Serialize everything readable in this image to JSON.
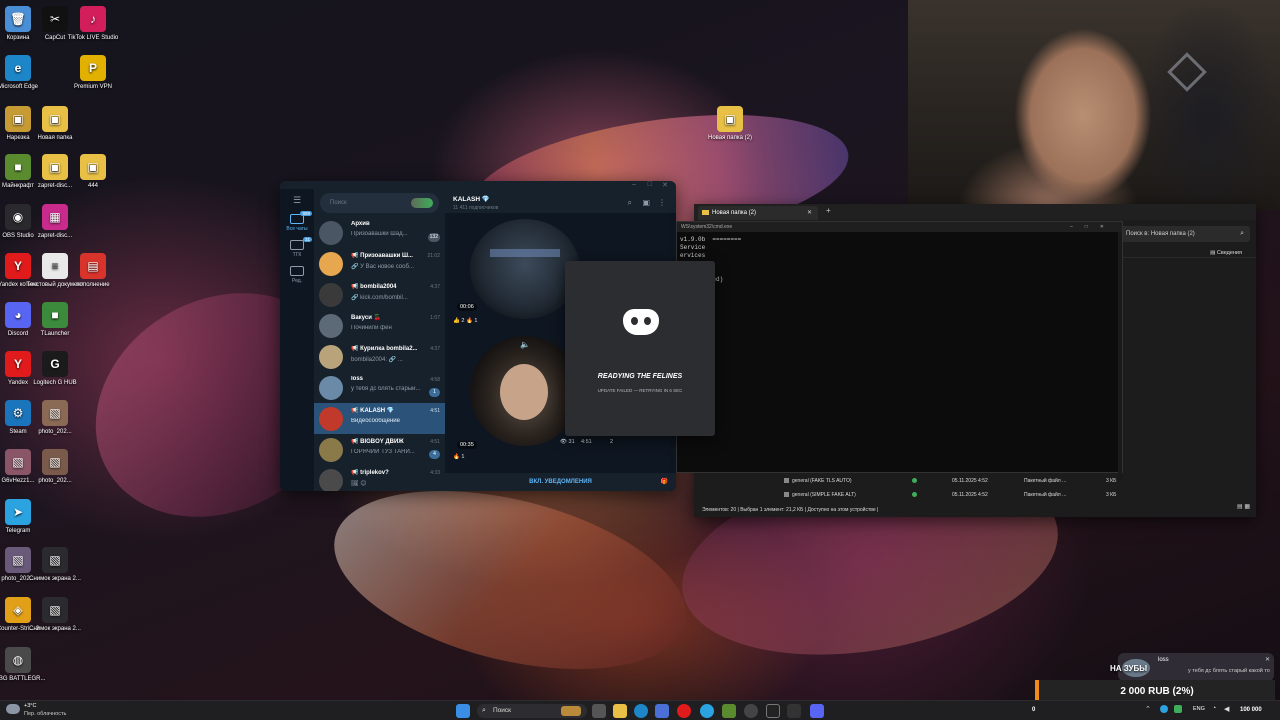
{
  "desktop": {
    "icons": [
      {
        "label": "Корзина",
        "color": "#4a8fd6",
        "glyph": "🗑"
      },
      {
        "label": "CapCut",
        "color": "#111111",
        "glyph": "✂"
      },
      {
        "label": "TikTok LIVE Studio",
        "color": "#d21e5b",
        "glyph": "♪"
      },
      {
        "label": "Microsoft Edge",
        "color": "#1d86c9",
        "glyph": "e"
      },
      {
        "label": "Premium VPN",
        "color": "#e2b100",
        "glyph": "P"
      },
      {
        "label": "Нарезка",
        "color": "#c69b33",
        "glyph": "▣"
      },
      {
        "label": "Новая папка",
        "color": "#e8c045",
        "glyph": "▣"
      },
      {
        "label": "Майнкрафт",
        "color": "#5a8c2f",
        "glyph": "■"
      },
      {
        "label": "zapret-disc...",
        "color": "#e8c045",
        "glyph": "▣"
      },
      {
        "label": "444",
        "color": "#e8c045",
        "glyph": "▣"
      },
      {
        "label": "OBS Studio",
        "color": "#2a2a2e",
        "glyph": "◉"
      },
      {
        "label": "zapret-disc...",
        "color": "#c82b8b",
        "glyph": "▦"
      },
      {
        "label": "Yandex котика",
        "color": "#e11b1b",
        "glyph": "Y"
      },
      {
        "label": "Текстовый документ",
        "color": "#e9e9e9",
        "glyph": "≡"
      },
      {
        "label": "пополнение",
        "color": "#d8342c",
        "glyph": "▤"
      },
      {
        "label": "Discord",
        "color": "#5865f2",
        "glyph": "◕"
      },
      {
        "label": "TLauncher",
        "color": "#3c8a3c",
        "glyph": "■"
      },
      {
        "label": "Yandex",
        "color": "#e11b1b",
        "glyph": "Y"
      },
      {
        "label": "Logitech G HUB",
        "color": "#1b1b1b",
        "glyph": "G"
      },
      {
        "label": "Steam",
        "color": "#1b75bc",
        "glyph": "⚙"
      },
      {
        "label": "photo_202...",
        "color": "#8a6a55",
        "glyph": "▧"
      },
      {
        "label": "G6vHezz1...",
        "color": "#8a5566",
        "glyph": "▧"
      },
      {
        "label": "photo_202...",
        "color": "#7a5a4a",
        "glyph": "▧"
      },
      {
        "label": "Telegram",
        "color": "#2aa3e0",
        "glyph": "➤"
      },
      {
        "label": "photo_202...",
        "color": "#6a5a7a",
        "glyph": "▧"
      },
      {
        "label": "Снимок экрана 2...",
        "color": "#2b2b2f",
        "glyph": "▧"
      },
      {
        "label": "Counter-Stri... 2",
        "color": "#e2a018",
        "glyph": "◈"
      },
      {
        "label": "Снимок экрана 2...",
        "color": "#2b2b2f",
        "glyph": "▧"
      },
      {
        "label": "PUBG BATTLEGR...",
        "color": "#4a4a4a",
        "glyph": "◍"
      },
      {
        "label": "Новая папка (2)",
        "color": "#e8c045",
        "glyph": "▣"
      }
    ]
  },
  "telegram": {
    "search_placeholder": "Поиск",
    "folders": [
      {
        "label": "Все чаты",
        "badge": "999"
      },
      {
        "label": "ТГК",
        "badge": "31"
      },
      {
        "label": "Ред.",
        "badge": ""
      }
    ],
    "chats": [
      {
        "name": "Архив",
        "msg": "Призоавашки Шад...",
        "time": "",
        "badge": "132",
        "color": "#4a5664"
      },
      {
        "name": "📢 Призоавашки Ш...",
        "msg": "🔗 У Вас новое сооб...",
        "time": "21:02",
        "badge": "",
        "color": "#e6a74f"
      },
      {
        "name": "📢 bombila2004",
        "msg": "🔗 kick.com/bombil...",
        "time": "4:37",
        "badge": "",
        "color": "#3a3a3a"
      },
      {
        "name": "Вакуси 🍒",
        "msg": "Починили фен",
        "time": "1:07",
        "badge": "",
        "color": "#5c6a78"
      },
      {
        "name": "📢 Курилка bombila2...",
        "msg": "bombila2004: 🔗 ...",
        "time": "4:37",
        "badge": "",
        "color": "#b9a37a"
      },
      {
        "name": "loss",
        "msg": "у тебя дс блять старый...",
        "time": "4:58",
        "badge": "1",
        "color": "#6a8aa8"
      },
      {
        "name": "📢 KALASH 💎",
        "msg": "Видеосообщение",
        "time": "4:51",
        "badge": "",
        "color": "#c0392b",
        "active": true
      },
      {
        "name": "📢 BIGBOY ДВИЖ",
        "msg": "ГОРЯЧИЙ ТУЗ ТАНИ...",
        "time": "4:51",
        "badge": "4",
        "color": "#8a7a4a"
      },
      {
        "name": "📢 triplekov?",
        "msg": "🖼 😊",
        "time": "4:33",
        "badge": "",
        "color": "#4a4a4a"
      }
    ],
    "chat": {
      "title": "KALASH 💎",
      "subtitle": "11 411 подписчиков",
      "video1_time": "00:06",
      "video1_reactions": "👍 2   🔥 1",
      "video2_time": "00:35",
      "video2_reactions": "🔥 1",
      "video2_views": "👁 31",
      "video2_clock": "4:51",
      "video2_count": "2",
      "notify_button": "ВКЛ. УВЕДОМЛЕНИЯ"
    }
  },
  "discord": {
    "status": "READYING THE FELINES",
    "update": "UPDATE FAILED — RETRYING IN 6 SEC"
  },
  "explorer": {
    "tab_title": "Новая папка (2)",
    "search_placeholder": "Поиск в: Новая папка (2)",
    "details_label": "Сведения",
    "files": [
      {
        "name": "general (FAKE TLS AUTO)",
        "date": "05.11.2025 4:52",
        "type": "Пакетный файл ...",
        "size": "3 КБ"
      },
      {
        "name": "general (SIMPLE FAKE ALT)",
        "date": "05.11.2025 4:52",
        "type": "Пакетный файл ...",
        "size": "3 КБ"
      }
    ],
    "status": "Элементов: 20   |   Выбран 1 элемент: 21,2 КБ   |   Доступно на этом устройстве   |"
  },
  "cmd": {
    "title": "WS\\system32\\cmd.exe",
    "lines": [
      "v1.9.0b  ========",
      "Service",
      "ervices",
      "",
      "",
      "r (disabled)",
      "e)"
    ]
  },
  "stream_overlay": {
    "goal_title": "НА ЗУБЫ",
    "goal_amount": "2 000 RUB (2%)",
    "notif_sender": "loss",
    "notif_msg": "у тебя дс блять старый какой то",
    "zero": "0",
    "target": "100 000"
  },
  "taskbar": {
    "search_label": "Поиск",
    "temperature": "+3°С",
    "weather": "Пер. облачность",
    "lang": "ENG",
    "clock": ""
  }
}
